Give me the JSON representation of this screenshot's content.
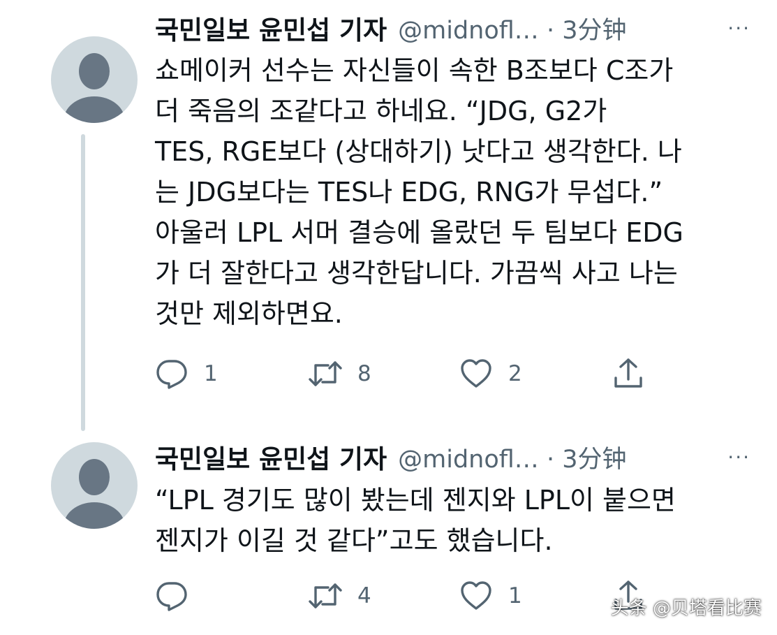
{
  "tweets": [
    {
      "author_name": "국민일보 윤민섭 기자",
      "handle": "@midnofl…",
      "time": "· 3分钟",
      "more": "···",
      "text_lines": [
        "쇼메이커 선수는 자신들이 속한 B조보다 C조가",
        "더 죽음의 조같다고 하네요.  “JDG, G2가",
        "TES, RGE보다 (상대하기) 낫다고 생각한다. 나",
        "는 JDG보다는 TES나 EDG, RNG가 무섭다.”",
        "아울러 LPL 서머 결승에 올랐던 두 팀보다 EDG",
        "가 더 잘한다고 생각한답니다. 가끔씩 사고 나는",
        "것만 제외하면요."
      ],
      "reply_count": "1",
      "retweet_count": "8",
      "like_count": "2"
    },
    {
      "author_name": "국민일보 윤민섭 기자",
      "handle": "@midnofl…",
      "time": "· 3分钟",
      "more": "···",
      "text_lines": [
        "“LPL 경기도 많이 봤는데 젠지와 LPL이 붙으면",
        "젠지가 이길 것 같다”고도 했습니다."
      ],
      "reply_count": "",
      "retweet_count": "4",
      "like_count": "1"
    }
  ],
  "watermark": "头条 @贝塔看比赛",
  "icons": {
    "reply": "reply-icon",
    "retweet": "retweet-icon",
    "like": "heart-icon",
    "share": "share-icon",
    "more": "more-icon"
  },
  "colors": {
    "text": "#0f1419",
    "secondary": "#536471",
    "thread_line": "#cfd9de",
    "avatar_bg": "#cfd9de",
    "avatar_fg": "#687684"
  }
}
